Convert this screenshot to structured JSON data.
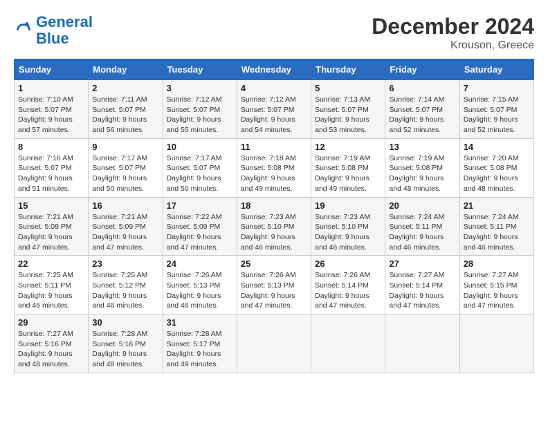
{
  "header": {
    "logo_line1": "General",
    "logo_line2": "Blue",
    "month": "December 2024",
    "location": "Krouson, Greece"
  },
  "days_of_week": [
    "Sunday",
    "Monday",
    "Tuesday",
    "Wednesday",
    "Thursday",
    "Friday",
    "Saturday"
  ],
  "weeks": [
    [
      {
        "day": 1,
        "sunrise": "7:10 AM",
        "sunset": "5:07 PM",
        "daylight": "9 hours and 57 minutes."
      },
      {
        "day": 2,
        "sunrise": "7:11 AM",
        "sunset": "5:07 PM",
        "daylight": "9 hours and 56 minutes."
      },
      {
        "day": 3,
        "sunrise": "7:12 AM",
        "sunset": "5:07 PM",
        "daylight": "9 hours and 55 minutes."
      },
      {
        "day": 4,
        "sunrise": "7:12 AM",
        "sunset": "5:07 PM",
        "daylight": "9 hours and 54 minutes."
      },
      {
        "day": 5,
        "sunrise": "7:13 AM",
        "sunset": "5:07 PM",
        "daylight": "9 hours and 53 minutes."
      },
      {
        "day": 6,
        "sunrise": "7:14 AM",
        "sunset": "5:07 PM",
        "daylight": "9 hours and 52 minutes."
      },
      {
        "day": 7,
        "sunrise": "7:15 AM",
        "sunset": "5:07 PM",
        "daylight": "9 hours and 52 minutes."
      }
    ],
    [
      {
        "day": 8,
        "sunrise": "7:16 AM",
        "sunset": "5:07 PM",
        "daylight": "9 hours and 51 minutes."
      },
      {
        "day": 9,
        "sunrise": "7:17 AM",
        "sunset": "5:07 PM",
        "daylight": "9 hours and 50 minutes."
      },
      {
        "day": 10,
        "sunrise": "7:17 AM",
        "sunset": "5:07 PM",
        "daylight": "9 hours and 50 minutes."
      },
      {
        "day": 11,
        "sunrise": "7:18 AM",
        "sunset": "5:08 PM",
        "daylight": "9 hours and 49 minutes."
      },
      {
        "day": 12,
        "sunrise": "7:19 AM",
        "sunset": "5:08 PM",
        "daylight": "9 hours and 49 minutes."
      },
      {
        "day": 13,
        "sunrise": "7:19 AM",
        "sunset": "5:08 PM",
        "daylight": "9 hours and 48 minutes."
      },
      {
        "day": 14,
        "sunrise": "7:20 AM",
        "sunset": "5:08 PM",
        "daylight": "9 hours and 48 minutes."
      }
    ],
    [
      {
        "day": 15,
        "sunrise": "7:21 AM",
        "sunset": "5:09 PM",
        "daylight": "9 hours and 47 minutes."
      },
      {
        "day": 16,
        "sunrise": "7:21 AM",
        "sunset": "5:09 PM",
        "daylight": "9 hours and 47 minutes."
      },
      {
        "day": 17,
        "sunrise": "7:22 AM",
        "sunset": "5:09 PM",
        "daylight": "9 hours and 47 minutes."
      },
      {
        "day": 18,
        "sunrise": "7:23 AM",
        "sunset": "5:10 PM",
        "daylight": "9 hours and 46 minutes."
      },
      {
        "day": 19,
        "sunrise": "7:23 AM",
        "sunset": "5:10 PM",
        "daylight": "9 hours and 46 minutes."
      },
      {
        "day": 20,
        "sunrise": "7:24 AM",
        "sunset": "5:11 PM",
        "daylight": "9 hours and 46 minutes."
      },
      {
        "day": 21,
        "sunrise": "7:24 AM",
        "sunset": "5:11 PM",
        "daylight": "9 hours and 46 minutes."
      }
    ],
    [
      {
        "day": 22,
        "sunrise": "7:25 AM",
        "sunset": "5:11 PM",
        "daylight": "9 hours and 46 minutes."
      },
      {
        "day": 23,
        "sunrise": "7:25 AM",
        "sunset": "5:12 PM",
        "daylight": "9 hours and 46 minutes."
      },
      {
        "day": 24,
        "sunrise": "7:26 AM",
        "sunset": "5:13 PM",
        "daylight": "9 hours and 46 minutes."
      },
      {
        "day": 25,
        "sunrise": "7:26 AM",
        "sunset": "5:13 PM",
        "daylight": "9 hours and 47 minutes."
      },
      {
        "day": 26,
        "sunrise": "7:26 AM",
        "sunset": "5:14 PM",
        "daylight": "9 hours and 47 minutes."
      },
      {
        "day": 27,
        "sunrise": "7:27 AM",
        "sunset": "5:14 PM",
        "daylight": "9 hours and 47 minutes."
      },
      {
        "day": 28,
        "sunrise": "7:27 AM",
        "sunset": "5:15 PM",
        "daylight": "9 hours and 47 minutes."
      }
    ],
    [
      {
        "day": 29,
        "sunrise": "7:27 AM",
        "sunset": "5:16 PM",
        "daylight": "9 hours and 48 minutes."
      },
      {
        "day": 30,
        "sunrise": "7:28 AM",
        "sunset": "5:16 PM",
        "daylight": "9 hours and 48 minutes."
      },
      {
        "day": 31,
        "sunrise": "7:28 AM",
        "sunset": "5:17 PM",
        "daylight": "9 hours and 49 minutes."
      },
      null,
      null,
      null,
      null
    ]
  ]
}
